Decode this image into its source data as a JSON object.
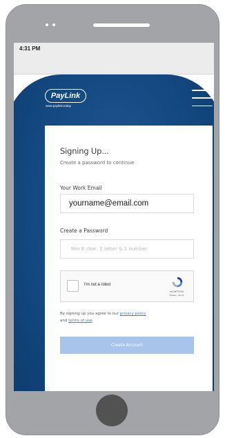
{
  "status_bar": {
    "time": "4:31 PM"
  },
  "header": {
    "logo_text": "PayLink",
    "logo_url": "www.paylink.today"
  },
  "form": {
    "title": "Signing Up...",
    "subtitle": "Create a password to continue",
    "email_label": "Your Work Email",
    "email_value": "yourname@email.com",
    "password_label": "Create a Password",
    "password_placeholder": "Min 8 char, 1 letter & 1 number",
    "captcha_label": "I'm not a robot",
    "captcha_brand": "reCAPTCHA",
    "captcha_links": "Privacy - Terms",
    "terms_prefix": "By signing up you agree to our",
    "privacy_link": "privacy policy",
    "terms_and": "and",
    "terms_link": "terms of use",
    "terms_suffix": ".",
    "create_button": "Create Account"
  },
  "colors": {
    "brand_blue": "#134880",
    "button_disabled": "#a8c4ea",
    "link": "#3b7bd6"
  }
}
